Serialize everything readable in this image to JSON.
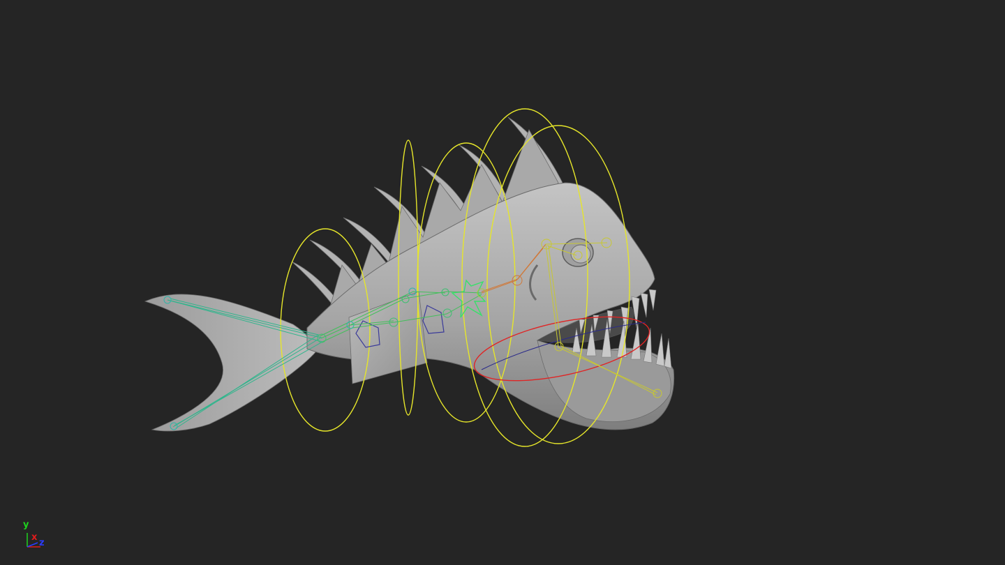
{
  "viewport": {
    "background": "#252525",
    "model": "fish-rig",
    "mesh_color": "#a8a8a8"
  },
  "colors": {
    "ik_control": "#e6e62a",
    "jaw_control": "#e02424",
    "spine_joint": "#3cbf70",
    "tail_joint": "#2fb5a8",
    "head_joint": "#c8c832",
    "neck_joint": "#d07838",
    "gizmo_x": "#e01c1c",
    "gizmo_y": "#1ed21e",
    "gizmo_z": "#2a3cff"
  },
  "axis_gizmo": {
    "y_label": "y",
    "x_label": "x",
    "z_label": "z"
  }
}
